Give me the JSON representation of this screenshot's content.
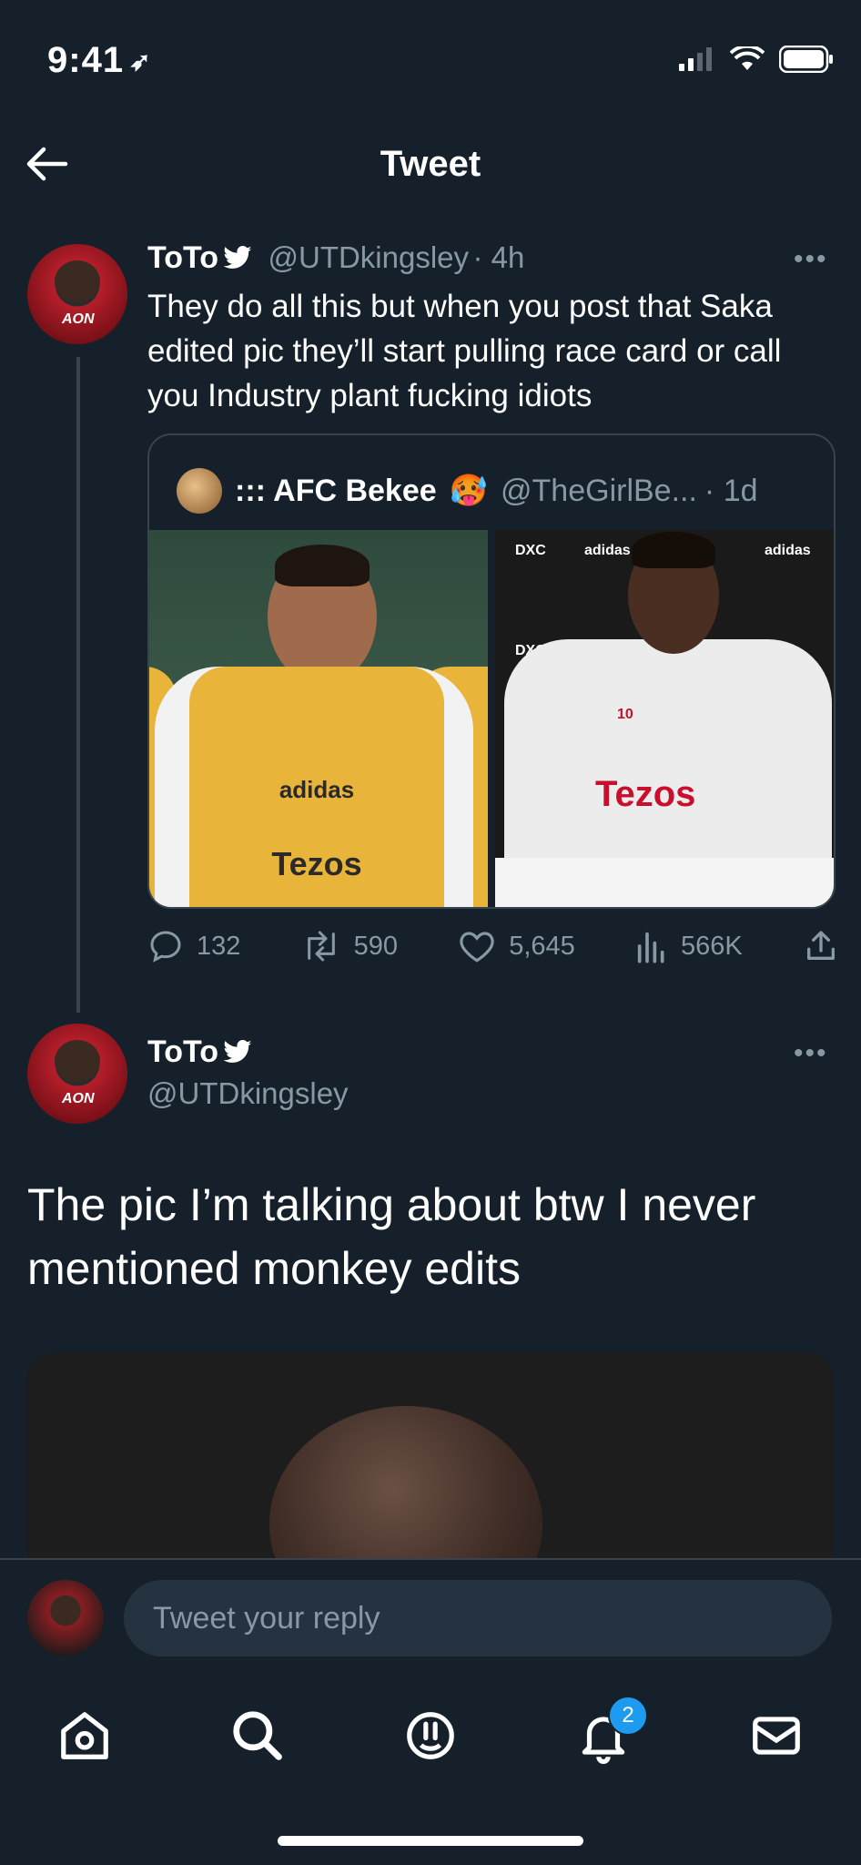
{
  "status_bar": {
    "time": "9:41"
  },
  "header": {
    "title": "Tweet"
  },
  "reply_tweet": {
    "name": "ToTo",
    "handle": "@UTDkingsley",
    "time": "· 4h",
    "text": "They do all this but when you post that Saka edited pic they’ll start pulling race card or call you Industry plant fucking idiots",
    "avatar_text": "AON",
    "quote": {
      "name": "::: AFC Bekee",
      "emoji": "🥵",
      "handle": "@TheGirlBe...",
      "time": "· 1d",
      "img_left_brand": "adidas",
      "img_left_sponsor": "Tezos",
      "img_right_sponsor": "Tezos",
      "img_right_number": "10",
      "img_right_board": "DXC",
      "img_right_board2": "adidas"
    },
    "actions": {
      "replies": "132",
      "retweets": "590",
      "likes": "5,645",
      "views": "566K"
    }
  },
  "main_tweet": {
    "name": "ToTo",
    "handle": "@UTDkingsley",
    "avatar_text": "AON",
    "text": "The pic I’m talking about btw I never mentioned monkey edits"
  },
  "reply_bar": {
    "placeholder": "Tweet your reply"
  },
  "tabbar": {
    "notifications_badge": "2"
  },
  "colors": {
    "background": "#15202b",
    "secondary_text": "#8899a6",
    "accent": "#1d9bf0",
    "border": "#38444d"
  }
}
